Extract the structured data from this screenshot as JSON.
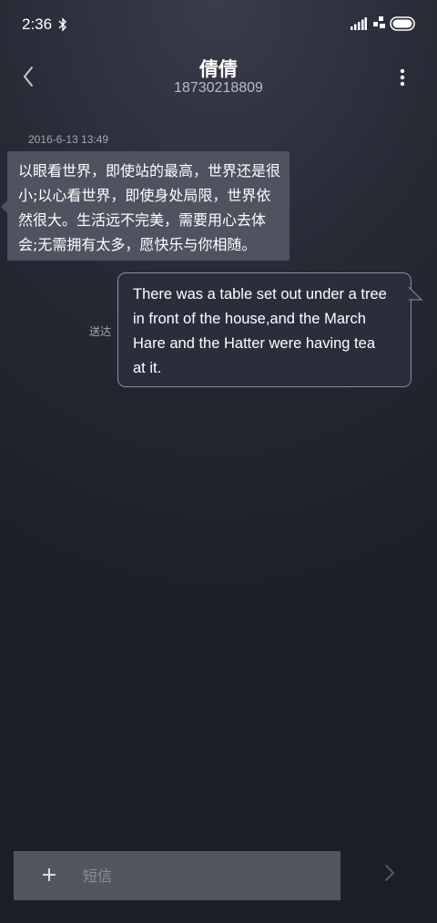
{
  "status_bar": {
    "time": "2:36",
    "icons": [
      "bluetooth-icon",
      "signal-icon",
      "wifi-icon",
      "battery-icon"
    ]
  },
  "header": {
    "contact_name": "倩倩",
    "contact_number": "18730218809",
    "icons": [
      "back-arrow-icon",
      "more-vertical-icon"
    ]
  },
  "conversation": {
    "timestamp": "2016-6-13 13:49",
    "messages": [
      {
        "direction": "incoming",
        "lines": [
          "以眼看世界，即使站的最高，世界还是很",
          "小;以心看世界，即使身处局限，世界依",
          "然很大。生活远不完美，需要用心去体",
          "会;无需拥有太多，愿快乐与你相随。"
        ]
      },
      {
        "direction": "outgoing",
        "status": "送达",
        "lines": [
          "There was a table set out under a tree",
          "in front of the house,and the March",
          "Hare and the Hatter were having tea",
          "at it."
        ]
      }
    ]
  },
  "compose": {
    "plus_label": "+",
    "placeholder": "短信",
    "value": "",
    "icons": [
      "send-icon"
    ]
  },
  "colors": {
    "background_top": "#3a3c4a",
    "background_bottom": "#1b1d29",
    "incoming_bubble": "#50525f",
    "outgoing_bubble": "#2b2d3b",
    "outgoing_border": "#8a8c98",
    "compose_bar": "#54565e",
    "muted_text": "#a4a6b2"
  }
}
